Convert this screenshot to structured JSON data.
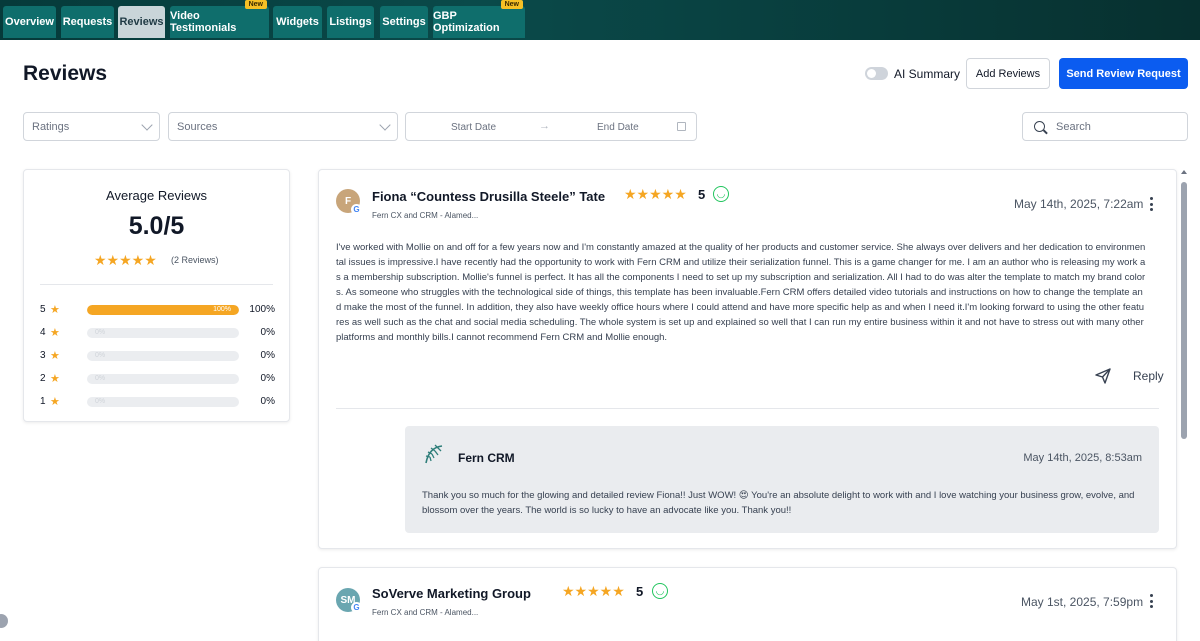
{
  "nav": {
    "tabs": [
      {
        "label": "Overview",
        "new": ""
      },
      {
        "label": "Requests",
        "new": ""
      },
      {
        "label": "Reviews",
        "new": ""
      },
      {
        "label": "Video Testimonials",
        "new": "New"
      },
      {
        "label": "Widgets",
        "new": ""
      },
      {
        "label": "Listings",
        "new": ""
      },
      {
        "label": "Settings",
        "new": ""
      },
      {
        "label": "GBP Optimization",
        "new": "New"
      }
    ],
    "active": "Reviews"
  },
  "header": {
    "title": "Reviews",
    "ai_summary_label": "AI Summary",
    "ai_summary_on": false,
    "add_reviews_label": "Add Reviews",
    "send_request_label": "Send Review Request"
  },
  "filters": {
    "ratings_placeholder": "Ratings",
    "sources_placeholder": "Sources",
    "start_date_placeholder": "Start Date",
    "end_date_placeholder": "End Date",
    "search_placeholder": "Search"
  },
  "average": {
    "title": "Average Reviews",
    "score": "5.0/5",
    "stars": "★★★★★",
    "count": "(2 Reviews)",
    "distribution": [
      {
        "stars": "5",
        "percent": 100,
        "bar_label": "100%",
        "percent_label": "100%"
      },
      {
        "stars": "4",
        "percent": 0,
        "bar_label": "0%",
        "percent_label": "0%"
      },
      {
        "stars": "3",
        "percent": 0,
        "bar_label": "0%",
        "percent_label": "0%"
      },
      {
        "stars": "2",
        "percent": 0,
        "bar_label": "0%",
        "percent_label": "0%"
      },
      {
        "stars": "1",
        "percent": 0,
        "bar_label": "0%",
        "percent_label": "0%"
      }
    ]
  },
  "reviews": [
    {
      "avatar_initials": "F",
      "name": "Fiona “Countess Drusilla Steele” Tate",
      "source": "Fern CX and CRM - Alamed...",
      "stars": "★★★★★",
      "rating": "5",
      "date": "May 14th, 2025, 7:22am",
      "text": "I've worked with Mollie on and off for a few years now and I'm constantly amazed at the quality of her products and customer service. She always over delivers and her dedication to environmental issues is impressive.I have recently had the opportunity to work with Fern CRM and utilize their serialization funnel. This is a game changer for me. I am an author who is releasing my work as a membership subscription. Mollie's funnel is perfect. It has all the components I need to set up my subscription and serialization. All I had to do was alter the template to match my brand colors. As someone who struggles with the technological side of things, this template has been invaluable.Fern CRM offers detailed video tutorials and instructions on how to change the template and make the most of the funnel. In addition, they also have weekly office hours where I could attend and have more specific help as and when I need it.I'm looking forward to using the other features as well such as the chat and social media scheduling. The whole system is set up and explained so well that I can run my entire business within it and not have to stress out with many other platforms and monthly bills.I cannot recommend Fern CRM and Mollie enough.",
      "reply_label": "Reply",
      "response": {
        "name": "Fern CRM",
        "date": "May 14th, 2025, 8:53am",
        "text": "Thank you so much for the glowing and detailed review Fiona!! Just WOW! 😍 You're an absolute delight to work with and I love watching your business grow, evolve, and blossom over the years. The world is so lucky to have an advocate like you. Thank you!!"
      }
    },
    {
      "avatar_initials": "SM",
      "name": "SoVerve Marketing Group",
      "source": "Fern CX and CRM - Alamed...",
      "stars": "★★★★★",
      "rating": "5",
      "date": "May 1st, 2025, 7:59pm"
    }
  ],
  "colors": {
    "primary": "#0b5cf0",
    "star": "#f5a623",
    "nav_tab": "#0f6e6c",
    "positive": "#22c55e"
  }
}
